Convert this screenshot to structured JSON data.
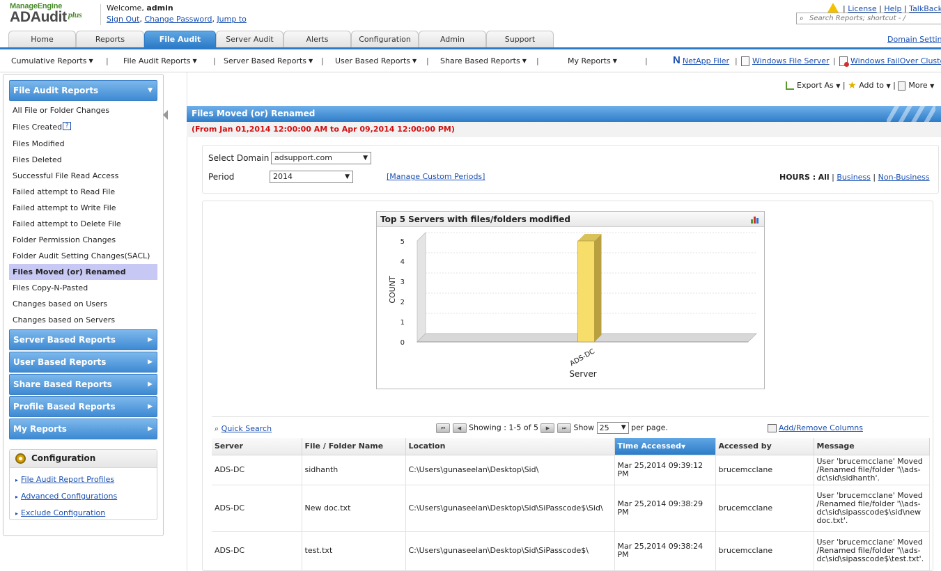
{
  "header": {
    "logo_brand": "ManageEngine",
    "logo_product": "ADAudit",
    "logo_suffix": "plus",
    "welcome_prefix": "Welcome,",
    "username": "admin",
    "sign_out": "Sign Out",
    "change_password": "Change Password",
    "jump_to": "Jump to",
    "license": "License",
    "help": "Help",
    "talkback": "TalkBack",
    "search_placeholder": "Search Reports; shortcut - /",
    "domain_settings": "Domain Settings"
  },
  "tabs": [
    {
      "label": "Home"
    },
    {
      "label": "Reports"
    },
    {
      "label": "File Audit",
      "active": true
    },
    {
      "label": "Server Audit"
    },
    {
      "label": "Alerts"
    },
    {
      "label": "Configuration"
    },
    {
      "label": "Admin"
    },
    {
      "label": "Support"
    }
  ],
  "subnav": {
    "cumulative": "Cumulative Reports",
    "file_audit": "File Audit Reports",
    "server_based": "Server Based Reports",
    "user_based": "User Based Reports",
    "share_based": "Share Based Reports",
    "my_reports": "My Reports",
    "netapp": "NetApp Filer",
    "windows_fs": "Windows File Server",
    "failover": "Windows FailOver Cluster"
  },
  "sidebar": {
    "file_audit_head": "File Audit Reports",
    "items": [
      "All File or Folder Changes",
      "Files Created",
      "Files Modified",
      "Files Deleted",
      "Successful File Read Access",
      "Failed attempt to Read File",
      "Failed attempt to Write File",
      "Failed attempt to Delete File",
      "Folder Permission Changes",
      "Folder Audit Setting Changes(SACL)",
      "Files Moved (or) Renamed",
      "Files Copy-N-Pasted",
      "Changes based on Users",
      "Changes based on Servers"
    ],
    "active_index": 10,
    "sections": [
      "Server Based Reports",
      "User Based Reports",
      "Share Based Reports",
      "Profile Based Reports",
      "My Reports"
    ],
    "config": {
      "title": "Configuration",
      "links": [
        "File Audit Report Profiles",
        "Advanced Configurations",
        "Exclude Configuration"
      ]
    }
  },
  "actions": {
    "export": "Export As",
    "add_to": "Add to",
    "more": "More"
  },
  "report": {
    "title": "Files Moved (or) Renamed",
    "date_range": "(From Jan 01,2014 12:00:00 AM to Apr 09,2014 12:00:00 PM)"
  },
  "filters": {
    "domain_label": "Select Domain",
    "domain_value": "adsupport.com",
    "period_label": "Period",
    "period_value": "2014",
    "manage_periods": "[Manage Custom Periods]",
    "hours_label": "HOURS :",
    "hours_all": "All",
    "business": "Business",
    "non_business": "Non-Business"
  },
  "chart_data": {
    "type": "bar",
    "title": "Top 5 Servers with files/folders modified",
    "categories": [
      "ADS-DC"
    ],
    "values": [
      5
    ],
    "xlabel": "Server",
    "ylabel": "COUNT",
    "ylim": [
      0,
      5
    ],
    "yticks": [
      0,
      1,
      2,
      3,
      4,
      5
    ],
    "grid": true,
    "bar_color": "#f7dd6a",
    "bar_side_color": "#b8a040"
  },
  "table": {
    "quick_search": "Quick Search",
    "showing_label": "Showing :",
    "showing_range": "1-5 of 5",
    "show_label": "Show",
    "page_size": "25",
    "per_page": "per page.",
    "add_remove": "Add/Remove Columns",
    "columns": [
      "Server",
      "File / Folder Name",
      "Location",
      "Time Accessed",
      "Accessed by",
      "Message"
    ],
    "sorted_column": 3,
    "rows": [
      {
        "server": "ADS-DC",
        "name": "sidhanth",
        "location": "C:\\Users\\gunaseelan\\Desktop\\Sid\\",
        "time": "Mar 25,2014 09:39:12 PM",
        "by": "brucemcclane",
        "message": "User 'brucemcclane' Moved /Renamed file/folder '\\\\ads-dc\\sid\\sidhanth'."
      },
      {
        "server": "ADS-DC",
        "name": "New doc.txt",
        "location": "C:\\Users\\gunaseelan\\Desktop\\Sid\\SiPasscode$\\Sid\\",
        "time": "Mar 25,2014 09:38:29 PM",
        "by": "brucemcclane",
        "message": "User 'brucemcclane' Moved /Renamed file/folder '\\\\ads-dc\\sid\\sipasscode$\\sid\\new doc.txt'."
      },
      {
        "server": "ADS-DC",
        "name": "test.txt",
        "location": "C:\\Users\\gunaseelan\\Desktop\\Sid\\SiPasscode$\\",
        "time": "Mar 25,2014 09:38:24 PM",
        "by": "brucemcclane",
        "message": "User 'brucemcclane' Moved /Renamed file/folder '\\\\ads-dc\\sid\\sipasscode$\\test.txt'."
      }
    ]
  }
}
